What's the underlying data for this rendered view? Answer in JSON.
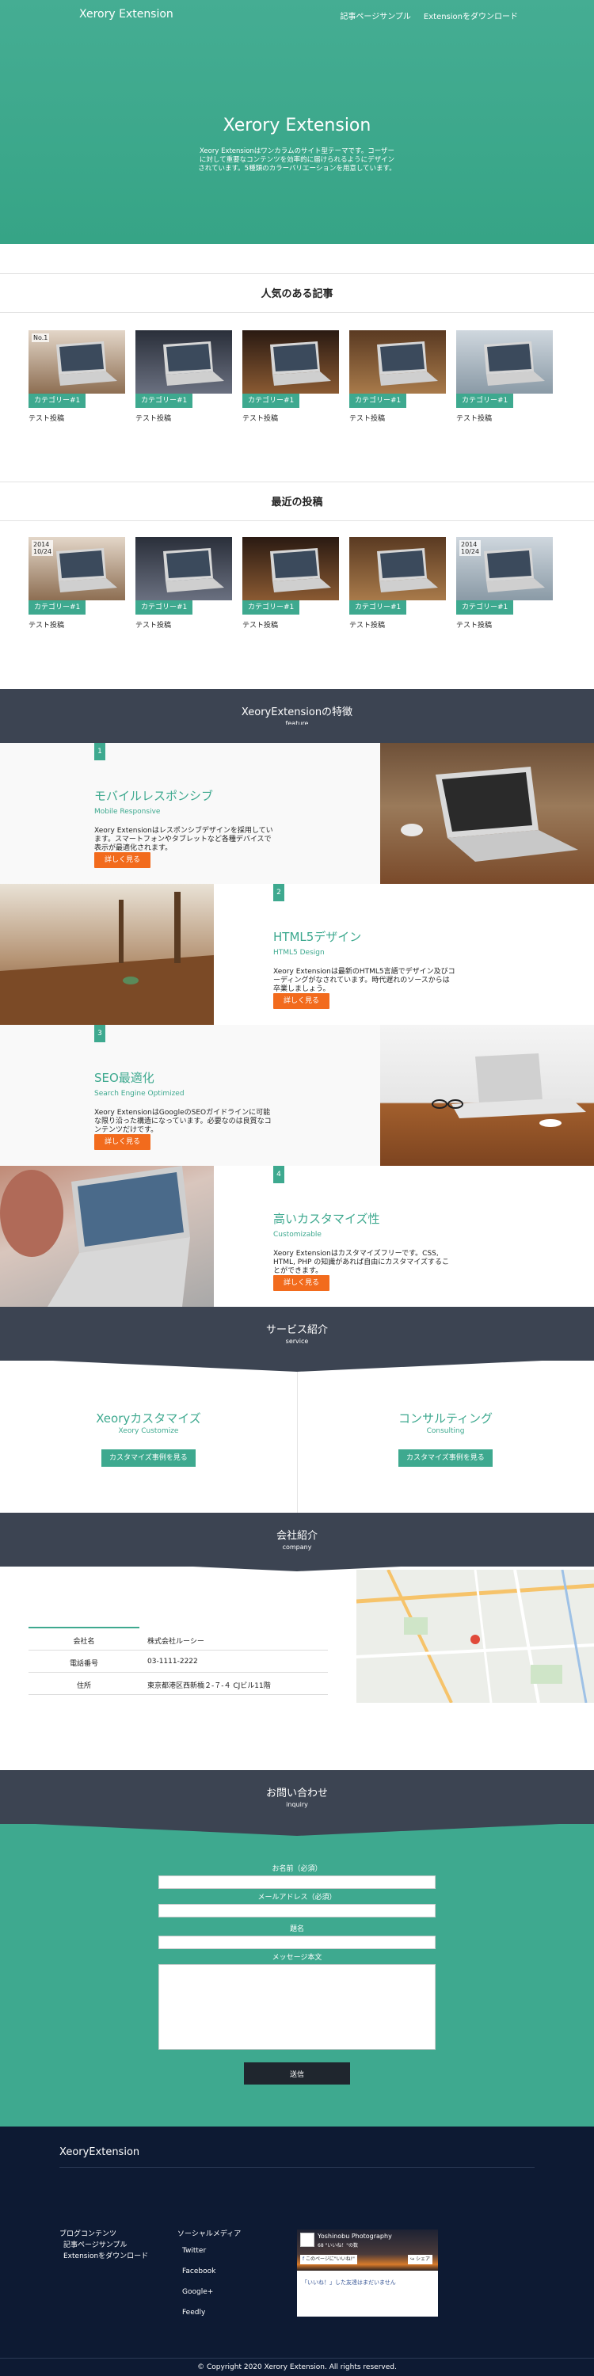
{
  "header": {
    "brand": "Xerory Extension",
    "nav": [
      "記事ページサンプル",
      "Extensionをダウンロード"
    ]
  },
  "hero": {
    "title": "Xerory Extension",
    "lead": "Xeory Extensionはワンカラムのサイト型テーマです。コーザーに対して重要なコンテンツを効率的に届けられるようにデザインされています。5種類のカラーバリエーションを用意しています。"
  },
  "popular": {
    "title": "人気のある記事",
    "cards": [
      {
        "corner": "No.1",
        "badge": "カテゴリー#1",
        "title": "テスト投稿"
      },
      {
        "corner": "",
        "badge": "カテゴリー#1",
        "title": "テスト投稿"
      },
      {
        "corner": "",
        "badge": "カテゴリー#1",
        "title": "テスト投稿"
      },
      {
        "corner": "",
        "badge": "カテゴリー#1",
        "title": "テスト投稿"
      },
      {
        "corner": "",
        "badge": "カテゴリー#1",
        "title": "テスト投稿"
      }
    ]
  },
  "recent": {
    "title": "最近の投稿",
    "cards": [
      {
        "corner": "2014\n10/24",
        "badge": "カテゴリー#1",
        "title": "テスト投稿"
      },
      {
        "corner": "",
        "badge": "カテゴリー#1",
        "title": "テスト投稿"
      },
      {
        "corner": "",
        "badge": "カテゴリー#1",
        "title": "テスト投稿"
      },
      {
        "corner": "",
        "badge": "カテゴリー#1",
        "title": "テスト投稿"
      },
      {
        "corner": "2014\n10/24",
        "badge": "カテゴリー#1",
        "title": "テスト投稿"
      }
    ]
  },
  "features": {
    "title": "XeoryExtensionの特徴",
    "subtitle": "feature",
    "items": [
      {
        "num": "1",
        "title": "モバイルレスポンシブ",
        "sub": "Mobile Responsive",
        "body": "Xeory Extensionはレスポンシブデザインを採用しています。スマートフォンやタブレットなど各種デバイスで表示が最適化されます。",
        "button": "詳しく見る"
      },
      {
        "num": "2",
        "title": "HTML5デザイン",
        "sub": "HTML5 Design",
        "body": "Xeory Extensionは最新のHTML5言語でデザイン及びコーディングがなされています。時代遅れのソースからは卒業しましょう。",
        "button": "詳しく見る"
      },
      {
        "num": "3",
        "title": "SEO最適化",
        "sub": "Search Engine Optimized",
        "body": "Xeory ExtensionはGoogleのSEOガイドラインに可能な限り沿った構造になっています。必要なのは良質なコンテンツだけです。",
        "button": "詳しく見る"
      },
      {
        "num": "4",
        "title": "高いカスタマイズ性",
        "sub": "Customizable",
        "body": "Xeory Extensionはカスタマイズフリーです。CSS, HTML, PHP の知識があれば自由にカスタマイズすることができます。",
        "button": "詳しく見る"
      }
    ]
  },
  "service": {
    "title": "サービス紹介",
    "subtitle": "service",
    "items": [
      {
        "title": "Xeoryカスタマイズ",
        "sub": "Xeory Customize",
        "button": "カスタマイズ事例を見る"
      },
      {
        "title": "コンサルティング",
        "sub": "Consulting",
        "button": "カスタマイズ事例を見る"
      }
    ]
  },
  "company": {
    "title": "会社紹介",
    "subtitle": "company",
    "rows": [
      {
        "k": "会社名",
        "v": "株式会社ルーシー"
      },
      {
        "k": "電話番号",
        "v": "03-1111-2222"
      },
      {
        "k": "住所",
        "v": "東京都港区西新橋２-７-４ CJビル11階"
      }
    ]
  },
  "inquiry": {
    "title": "お問い合わせ",
    "subtitle": "inquiry",
    "fields": [
      "お名前（必須）",
      "メールアドレス（必須）",
      "題名",
      "メッセージ本文"
    ],
    "submit": "送信"
  },
  "footer": {
    "brand": "XeoryExtension",
    "col1_title": "ブログコンテンツ",
    "col1_items": [
      "記事ページサンプル",
      "Extensionをダウンロード"
    ],
    "col2_title": "ソーシャルメディア",
    "col2_items": [
      "Twitter",
      "Facebook",
      "Google+",
      "Feedly"
    ],
    "fb_page": "Yoshinobu Photography",
    "fb_likes": "68 \"いいね！\"の数",
    "fb_like_btn": "このページに\"いいね!\"",
    "fb_share": "シェア",
    "fb_post": "「いいね！」した友達はまだいません",
    "copyright": "© Copyright 2020 Xerory Extension. All rights reserved."
  },
  "colors": {
    "accent": "#3ea98f",
    "dark": "#3c4452",
    "orange": "#f26b1d",
    "footer": "#0d1a33"
  }
}
